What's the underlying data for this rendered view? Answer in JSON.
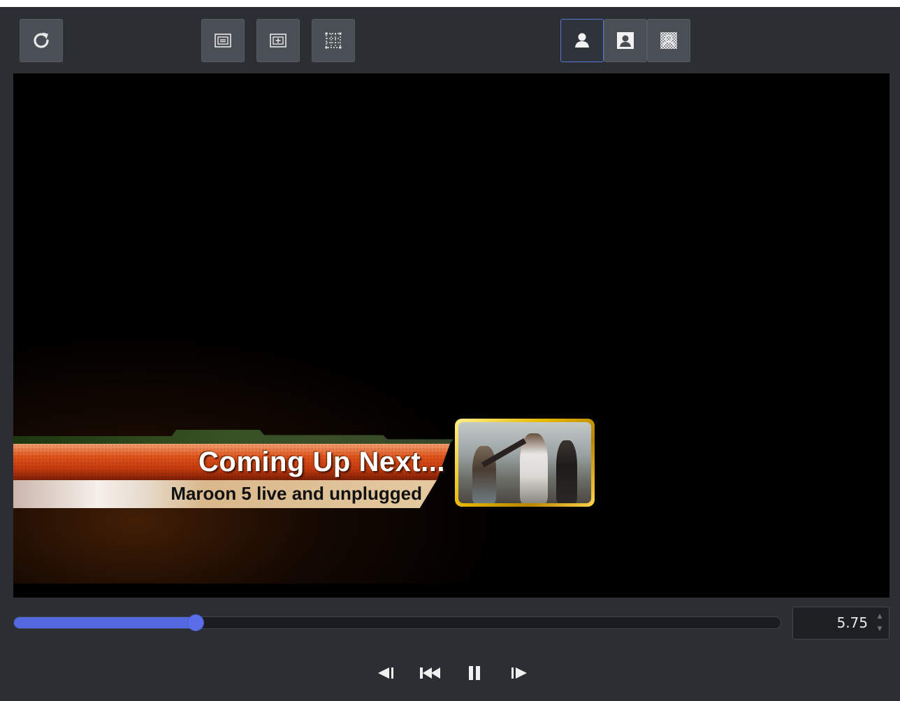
{
  "toolbar": {
    "buttons": [
      {
        "id": "reload",
        "icon": "reload-icon"
      },
      {
        "id": "title-safe",
        "icon": "title-safe-icon"
      },
      {
        "id": "action-safe",
        "icon": "action-safe-icon"
      },
      {
        "id": "grid",
        "icon": "grid-icon"
      },
      {
        "id": "mask-user",
        "icon": "user-icon",
        "active": true
      },
      {
        "id": "mask-user-frame",
        "icon": "user-frame-icon"
      },
      {
        "id": "mask-checker",
        "icon": "checker-icon"
      }
    ]
  },
  "preview": {
    "lower_third": {
      "title": "Coming Up Next...",
      "subtitle": "Maroon 5 live and unplugged"
    }
  },
  "timeline": {
    "position_fraction": 0.237,
    "value": "5.75"
  },
  "transport": {
    "buttons": [
      "step-back-icon",
      "skip-to-start-icon",
      "pause-icon",
      "step-forward-icon"
    ]
  },
  "colors": {
    "background": "#2b2e33",
    "accent": "#5468e0",
    "button": "#4a4e55"
  }
}
